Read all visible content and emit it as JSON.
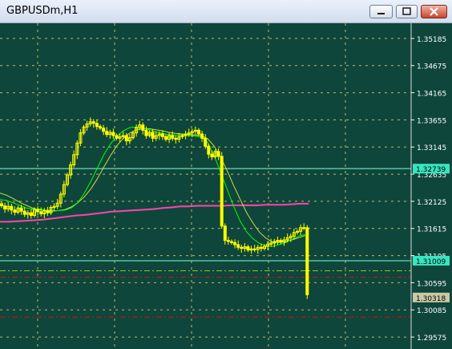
{
  "window": {
    "title": "GBPUSDm,H1"
  },
  "titlebar_buttons": {
    "minimize": "minimize-icon",
    "maximize": "maximize-icon",
    "close": "close-icon"
  },
  "colors": {
    "background": "#0f463b",
    "grid": "#c8c878",
    "candles": "#ffff00",
    "ma_fast": "#00ff00",
    "ma_medium": "#c8e040",
    "ma_slow": "#ff44aa",
    "level_line": "#7fffd4",
    "dashed_red": "#cc1111",
    "dashed_green": "#88cc22",
    "axis_text": "#ffffff"
  },
  "chart_data": {
    "type": "line",
    "symbol": "GBPUSDm",
    "timeframe": "H1",
    "y_axis": {
      "ticks": [
        "1.35185",
        "1.34675",
        "1.34165",
        "1.33655",
        "1.33145",
        "1.32635",
        "1.32125",
        "1.31615",
        "1.31105",
        "1.30595",
        "1.30085",
        "1.29575"
      ],
      "min": 1.2935,
      "max": 1.3547
    },
    "price_labels": [
      {
        "text": "1.32739",
        "value": 1.32739,
        "style": "level"
      },
      {
        "text": "1.31009",
        "value": 1.31009,
        "style": "level"
      },
      {
        "text": "1.30318",
        "value": 1.30318,
        "style": "bid"
      }
    ],
    "horizontal_levels": [
      {
        "value": 1.32739,
        "style": "solid",
        "color": "#7fffd4"
      },
      {
        "value": 1.31009,
        "style": "solid",
        "color": "#7fffd4"
      },
      {
        "value": 1.3082,
        "style": "dashdot",
        "color": "#88cc22"
      },
      {
        "value": 1.307,
        "style": "dashdot",
        "color": "#cc1111"
      },
      {
        "value": 1.2995,
        "style": "dashdot",
        "color": "#cc1111"
      }
    ],
    "series": [
      {
        "type": "candles",
        "close": [
          1.3204,
          1.3198,
          1.3203,
          1.3196,
          1.3192,
          1.32,
          1.3194,
          1.3188,
          1.3191,
          1.3186,
          1.3197,
          1.3193,
          1.3189,
          1.3195,
          1.3191,
          1.3201,
          1.3203,
          1.3209,
          1.3226,
          1.3244,
          1.3262,
          1.3281,
          1.33,
          1.3322,
          1.3341,
          1.3352,
          1.3358,
          1.3362,
          1.3359,
          1.3353,
          1.335,
          1.3344,
          1.3338,
          1.3342,
          1.3336,
          1.3331,
          1.3334,
          1.3336,
          1.3326,
          1.3332,
          1.3341,
          1.3351,
          1.3356,
          1.3346,
          1.3336,
          1.3342,
          1.3331,
          1.3336,
          1.3339,
          1.3334,
          1.3329,
          1.3336,
          1.3331,
          1.3329,
          1.3334,
          1.3336,
          1.3339,
          1.3341,
          1.3344,
          1.3346,
          1.3339,
          1.3331,
          1.3316,
          1.3301,
          1.3296,
          1.3306,
          1.3297,
          1.3166,
          1.3139,
          1.3137,
          1.3135,
          1.3131,
          1.3126,
          1.3124,
          1.3127,
          1.3121,
          1.3123,
          1.3122,
          1.3126,
          1.3124,
          1.3128,
          1.3132,
          1.3134,
          1.3137,
          1.3139,
          1.3136,
          1.314,
          1.3144,
          1.3147,
          1.3154,
          1.3156,
          1.3163,
          1.3163,
          1.3037
        ]
      },
      {
        "name": "",
        "role": "ma_fast",
        "values": [
          1.3216,
          1.3214,
          1.321,
          1.3205,
          1.32,
          1.3198,
          1.3198,
          1.3196,
          1.3195,
          1.3195,
          1.3196,
          1.32,
          1.321,
          1.3228,
          1.325,
          1.3275,
          1.33,
          1.332,
          1.3335,
          1.3345,
          1.3351,
          1.3352,
          1.335,
          1.3347,
          1.3343,
          1.334,
          1.3338,
          1.3337,
          1.3337,
          1.3336,
          1.3335,
          1.3333,
          1.3323,
          1.3298,
          1.3267,
          1.3235,
          1.3203,
          1.3175,
          1.3155,
          1.3142,
          1.3133,
          1.3129,
          1.3128,
          1.3131,
          1.3135,
          1.3141,
          1.3147,
          1.315
        ]
      },
      {
        "name": "",
        "role": "ma_medium",
        "values": [
          1.3228,
          1.3224,
          1.3218,
          1.3211,
          1.3205,
          1.32,
          1.3197,
          1.3195,
          1.3194,
          1.3195,
          1.3197,
          1.3202,
          1.321,
          1.3221,
          1.3236,
          1.3255,
          1.3277,
          1.3298,
          1.3317,
          1.3331,
          1.3341,
          1.3347,
          1.3349,
          1.3349,
          1.3347,
          1.3345,
          1.3342,
          1.334,
          1.3339,
          1.3338,
          1.3337,
          1.3336,
          1.333,
          1.3316,
          1.3295,
          1.327,
          1.3242,
          1.3216,
          1.3191,
          1.3171,
          1.3154,
          1.3143,
          1.3136,
          1.3135,
          1.3137,
          1.314,
          1.3144,
          1.3148
        ]
      },
      {
        "name": "",
        "role": "ma_slow",
        "values": [
          1.3174,
          1.3174,
          1.3175,
          1.3176,
          1.3177,
          1.3178,
          1.318,
          1.3182,
          1.3184,
          1.3186,
          1.3187,
          1.3189,
          1.3191,
          1.3193,
          1.3194,
          1.3195,
          1.3196,
          1.3197,
          1.3198,
          1.32,
          1.3201,
          1.3203,
          1.3203,
          1.3204,
          1.3204,
          1.3204,
          1.3204,
          1.3205,
          1.3205,
          1.3205,
          1.3205,
          1.3206,
          1.3206,
          1.3206,
          1.3207,
          1.3208,
          1.3208
        ]
      }
    ],
    "grid": true
  }
}
